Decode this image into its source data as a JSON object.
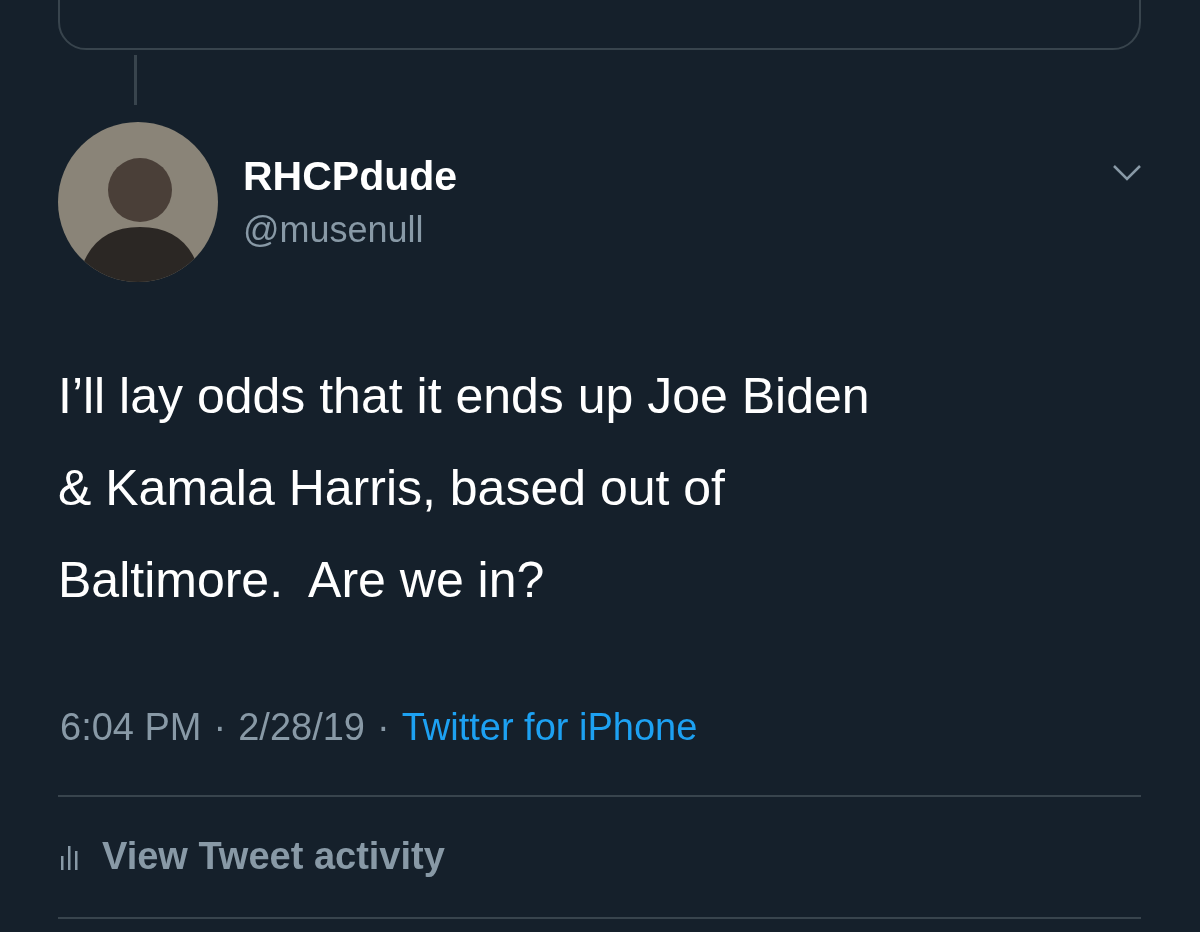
{
  "tweet": {
    "author_name": "RHCPdude",
    "handle": "@musenull",
    "text_lines": [
      "I’ll lay odds that it ends up Joe Biden",
      "& Kamala Harris, based out of",
      "Baltimore.  Are we in?"
    ],
    "time": "6:04 PM",
    "separator_1": "·",
    "date": "2/28/19",
    "separator_2": "·",
    "source": "Twitter for iPhone"
  },
  "actions": [
    {
      "label": "View Tweet activity"
    }
  ]
}
